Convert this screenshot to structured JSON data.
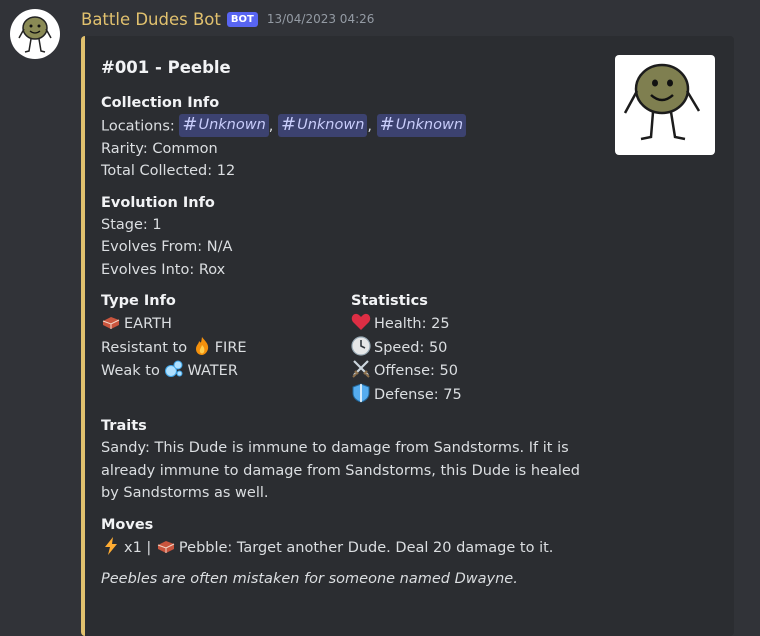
{
  "bot": {
    "name": "Battle Dudes Bot",
    "tag": "BOT",
    "timestamp": "13/04/2023 04:26"
  },
  "embed": {
    "title": "#001 - Peeble",
    "collection": {
      "heading": "Collection Info",
      "locations_label": "Locations: ",
      "locations": [
        "Unknown",
        "Unknown",
        "Unknown"
      ],
      "rarity": "Rarity: Common",
      "total": "Total Collected: 12"
    },
    "evolution": {
      "heading": "Evolution Info",
      "stage": "Stage: 1",
      "from": "Evolves From: N/A",
      "into": "Evolves Into: Rox"
    },
    "type": {
      "heading": "Type Info",
      "type": "EARTH",
      "resistant_label": "Resistant to ",
      "resistant": "FIRE",
      "weak_label": "Weak to ",
      "weak": "WATER"
    },
    "stats": {
      "heading": "Statistics",
      "health": "Health: 25",
      "speed": "Speed: 50",
      "offense": "Offense: 50",
      "defense": "Defense: 75"
    },
    "traits": {
      "heading": "Traits",
      "text": "Sandy: This Dude is immune to damage from Sandstorms. If it is already immune to damage from Sandstorms, this Dude is healed by Sandstorms as well."
    },
    "moves": {
      "heading": "Moves",
      "cost": "x1 | ",
      "text": "Pebble: Target another Dude. Deal 20 damage to it."
    },
    "flavor": "Peebles are often mistaken for someone named Dwayne."
  },
  "icons": {
    "earth": "brick-icon",
    "fire": "fire-icon",
    "water": "bubbles-icon",
    "health": "heart-icon",
    "speed": "clock-icon",
    "offense": "crossed-swords-icon",
    "defense": "shield-icon",
    "energy": "lightning-icon"
  },
  "colors": {
    "accent": "#e1c16e",
    "embed_bg": "#2b2d31",
    "channel_bg": "#3c4270"
  }
}
